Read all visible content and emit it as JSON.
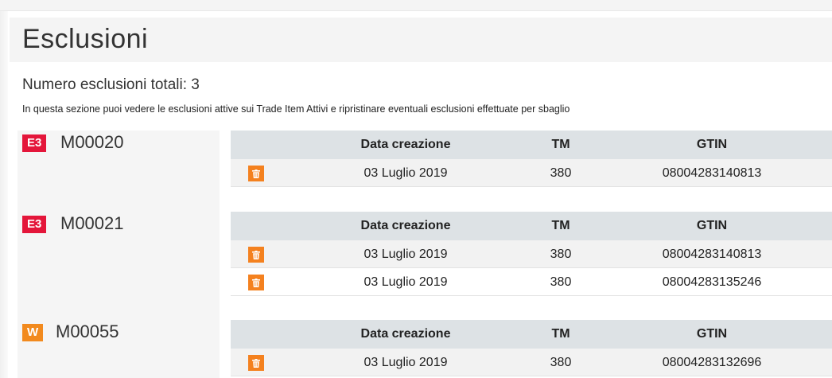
{
  "header": {
    "title": "Esclusioni"
  },
  "summary": {
    "count_text": "Numero esclusioni totali: 3",
    "description": "In questa sezione puoi vedere le esclusioni attive sui Trade Item Attivi e ripristinare eventuali esclusioni effettuate per sbaglio"
  },
  "columns": {
    "date": "Data creazione",
    "tm": "TM",
    "gtin": "GTIN"
  },
  "colors": {
    "badge_e3": "#e4163a",
    "badge_w": "#f28a1e",
    "delete_button": "#f4811f",
    "table_header": "#dde2e5"
  },
  "groups": [
    {
      "badge": "E3",
      "code": "M00020",
      "rows": [
        {
          "date": "03 Luglio 2019",
          "tm": "380",
          "gtin": "08004283140813",
          "icon": "trash-icon"
        }
      ]
    },
    {
      "badge": "E3",
      "code": "M00021",
      "rows": [
        {
          "date": "03 Luglio 2019",
          "tm": "380",
          "gtin": "08004283140813",
          "icon": "trash-icon"
        },
        {
          "date": "03 Luglio 2019",
          "tm": "380",
          "gtin": "08004283135246",
          "icon": "trash-icon"
        }
      ]
    },
    {
      "badge": "W",
      "code": "M00055",
      "rows": [
        {
          "date": "03 Luglio 2019",
          "tm": "380",
          "gtin": "08004283132696",
          "icon": "trash-icon"
        }
      ]
    }
  ]
}
